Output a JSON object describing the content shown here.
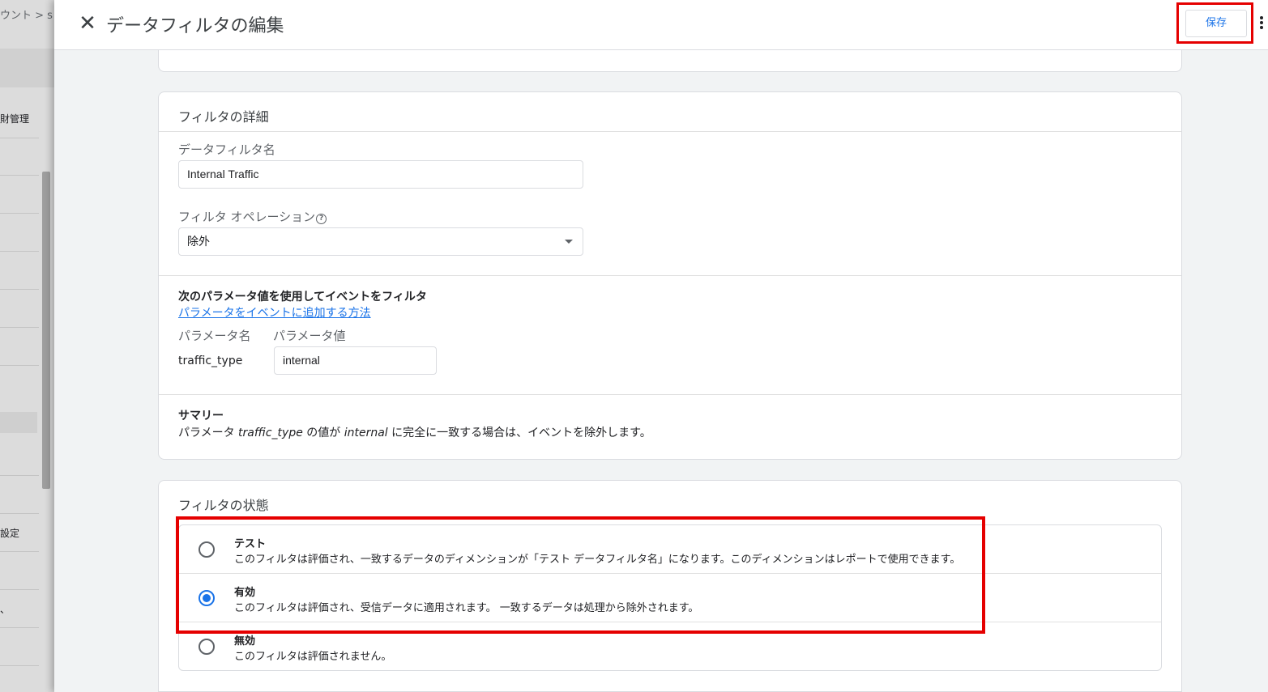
{
  "background": {
    "breadcrumb": "ウント > s",
    "items": [
      "財管理",
      "設定",
      "、"
    ]
  },
  "header": {
    "title": "データフィルタの編集",
    "save_label": "保存"
  },
  "filter_details": {
    "section_title": "フィルタの詳細",
    "name_label": "データフィルタ名",
    "name_value": "Internal Traffic",
    "operation_label": "フィルタ オペレーション",
    "operation_value": "除外",
    "params_heading": "次のパラメータ値を使用してイベントをフィルタ",
    "params_link": "パラメータをイベントに追加する方法",
    "param_name_header": "パラメータ名",
    "param_value_header": "パラメータ値",
    "param_name": "traffic_type",
    "param_value": "internal",
    "summary_title": "サマリー",
    "summary_prefix": "パラメータ ",
    "summary_param": "traffic_type",
    "summary_mid": " の値が ",
    "summary_value": "internal",
    "summary_suffix": " に完全に一致する場合は、イベントを除外します。"
  },
  "filter_status": {
    "section_title": "フィルタの状態",
    "selected": "有効",
    "options": [
      {
        "title": "テスト",
        "description": "このフィルタは評価され、一致するデータのディメンションが「テスト データフィルタ名」になります。このディメンションはレポートで使用できます。"
      },
      {
        "title": "有効",
        "description": "このフィルタは評価され、受信データに適用されます。 一致するデータは処理から除外されます。"
      },
      {
        "title": "無効",
        "description": "このフィルタは評価されません。"
      }
    ]
  },
  "colors": {
    "accent": "#1a73e8",
    "highlight": "#e50000"
  }
}
